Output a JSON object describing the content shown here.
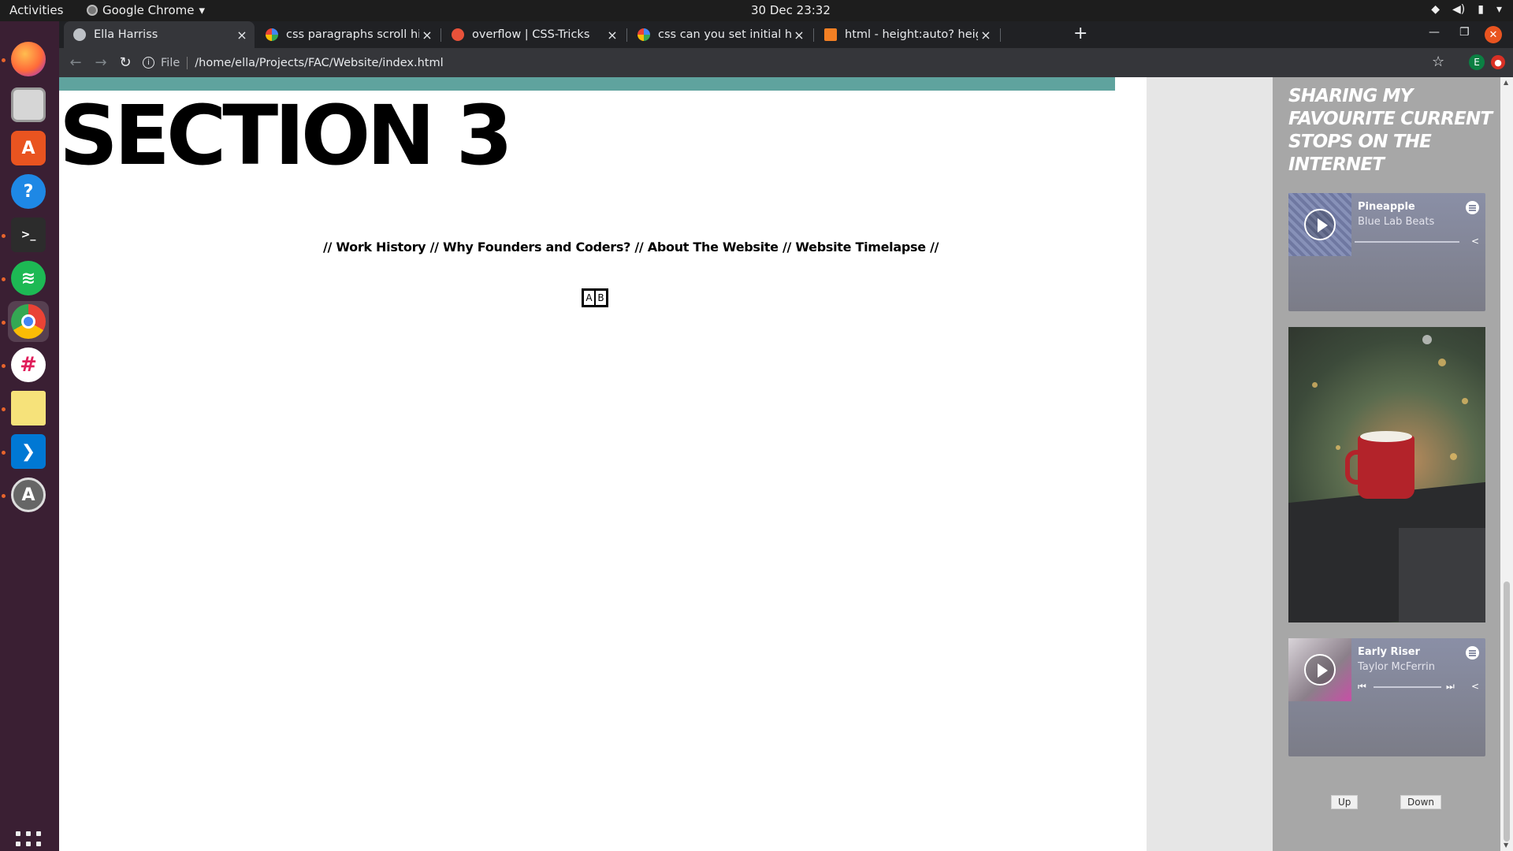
{
  "topbar": {
    "activities": "Activities",
    "app_name": "Google Chrome",
    "app_arrow": "▾",
    "clock": "30 Dec  23:32",
    "tray_icons": [
      "wifi-icon",
      "volume-icon",
      "battery-icon",
      "chevron-down-icon"
    ]
  },
  "dock": {
    "items": [
      "Firefox",
      "Files",
      "Ubuntu Software",
      "Help",
      "Terminal",
      "Spotify",
      "Google Chrome",
      "Slack",
      "Notes",
      "Visual Studio Code",
      "Software Updater"
    ],
    "show_apps_icon": "grid-icon"
  },
  "browser": {
    "tabs": [
      {
        "title": "Ella Harriss",
        "active": true
      },
      {
        "title": "css paragraphs scroll hidd",
        "active": false
      },
      {
        "title": "overflow | CSS-Tricks",
        "active": false
      },
      {
        "title": "css can you set initial heig",
        "active": false
      },
      {
        "title": "html - height:auto? height",
        "active": false
      }
    ],
    "close_glyph": "×",
    "new_tab": "+",
    "omnibox": {
      "scheme": "File",
      "url": "/home/ella/Projects/FAC/Website/index.html"
    },
    "profile_initial": "E"
  },
  "page": {
    "section_title": "SECTION 3",
    "nav": {
      "sep": "//",
      "links": [
        "Work History",
        "Why Founders and Coders?",
        "About The Website",
        "Website Timelapse"
      ]
    },
    "ab_buttons": [
      "A",
      "B"
    ]
  },
  "side_panel": {
    "heading": "Sharing my favourite current stops on the internet",
    "embeds": [
      {
        "track": "Pineapple",
        "artist": "Blue Lab Beats"
      },
      {
        "track": "Early Riser",
        "artist": "Taylor McFerrin"
      }
    ],
    "buttons": {
      "up": "Up",
      "down": "Down"
    }
  },
  "colors": {
    "teal": "#5fa39e",
    "panel_grey": "#a7a7a7",
    "dock_bg": "#3a1f33",
    "chrome_dark": "#202124",
    "ubuntu_orange": "#e95420"
  }
}
